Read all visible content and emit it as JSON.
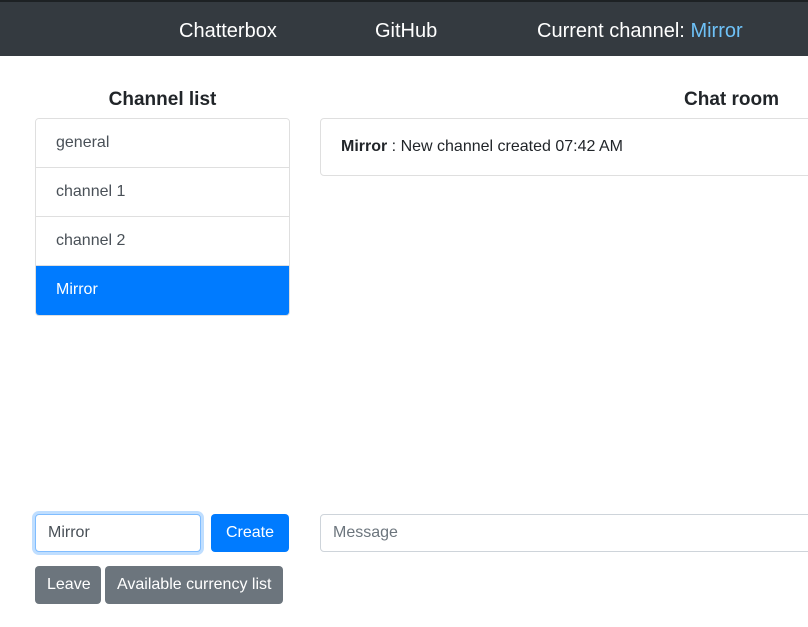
{
  "navbar": {
    "brand": "Chatterbox",
    "github": "GitHub",
    "current_channel_label": "Current channel:",
    "current_channel_value": "Mirror"
  },
  "channels": {
    "heading": "Channel list",
    "items": [
      {
        "label": "general"
      },
      {
        "label": "channel 1"
      },
      {
        "label": "channel 2"
      },
      {
        "label": "Mirror",
        "active": true
      }
    ]
  },
  "chat": {
    "heading": "Chat room",
    "messages": [
      {
        "author": "Mirror",
        "separator": " : ",
        "text": "New channel created 07:42 AM"
      }
    ]
  },
  "controls": {
    "channel_input_value": "Mirror",
    "create_label": "Create",
    "leave_label": "Leave",
    "currency_label": "Available currency list",
    "message_placeholder": "Message"
  },
  "colors": {
    "navbar_bg": "#343a40",
    "primary": "#007bff",
    "secondary": "#6c757d",
    "accent_link": "#6ec1f7"
  }
}
